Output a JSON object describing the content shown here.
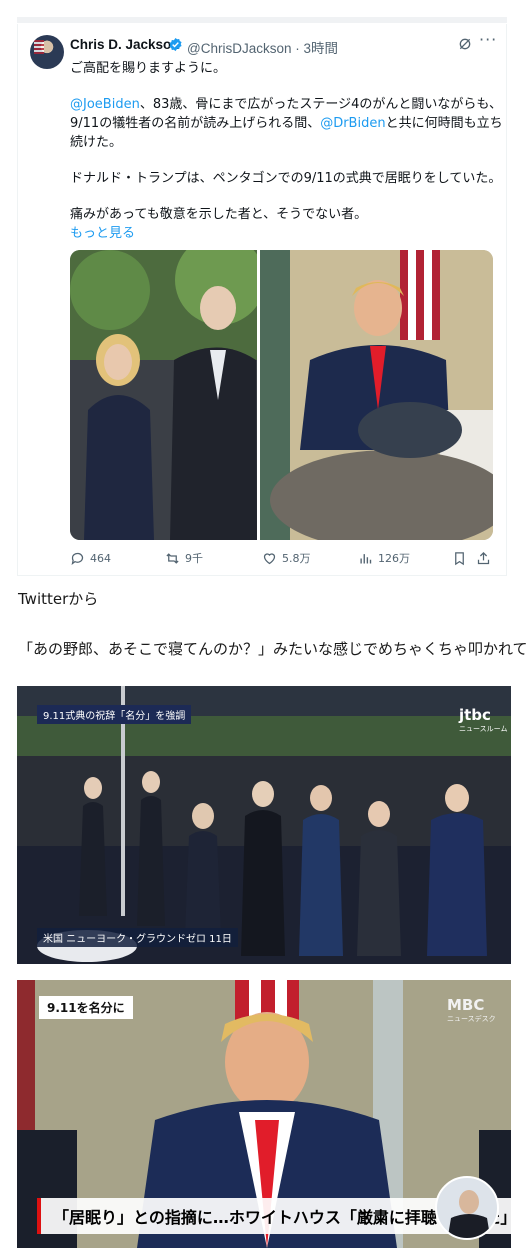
{
  "tweet": {
    "author_name": "Chris D. Jackson",
    "handle": "@ChrisDJackson",
    "time": "· 3時間",
    "lines": [
      {
        "text": "ご高配を賜りますように。"
      },
      {
        "mention": "@JoeBiden",
        "text": "、83歳、骨にまで広がったステージ4のがんと闘いながらも、"
      },
      {
        "text": "9/11の犠牲者の名前が読み上げられる間、",
        "mention": "@DrBiden",
        "text2": "と共に何時間も立ち"
      },
      {
        "text": "続けた。"
      },
      {
        "text": "ドナルド・トランプは、ペンタゴンでの9/11の式典で居眠りをしていた。"
      },
      {
        "text": "痛みがあっても敬意を示した者と、そうでない者。"
      }
    ],
    "show_more": "もっと見る",
    "stats": {
      "replies": "464",
      "reposts": "9千",
      "likes": "5.8万",
      "views": "126万"
    }
  },
  "captions": {
    "source": "Twitterから",
    "comment": "「あの野郎、あそこで寝てんのか？」みたいな感じでめちゃくちゃ叩かれてる"
  },
  "news1": {
    "tag": "9.11式典の祝辞「名分」を強調",
    "logo": "jtbc",
    "logo_sub": "ニュースルーム",
    "location": "米国 ニューヨーク・グラウンドゼロ 11日"
  },
  "news2": {
    "tag": "9.11を名分に",
    "logo": "MBC",
    "logo_sub": "ニュースデスク",
    "headline": "「居眠り」との指摘に…ホワイトハウス「厳粛に拝聴していた」"
  },
  "colors": {
    "link": "#1d9bf0",
    "muted": "#536471",
    "verified": "#1d9bf0"
  }
}
